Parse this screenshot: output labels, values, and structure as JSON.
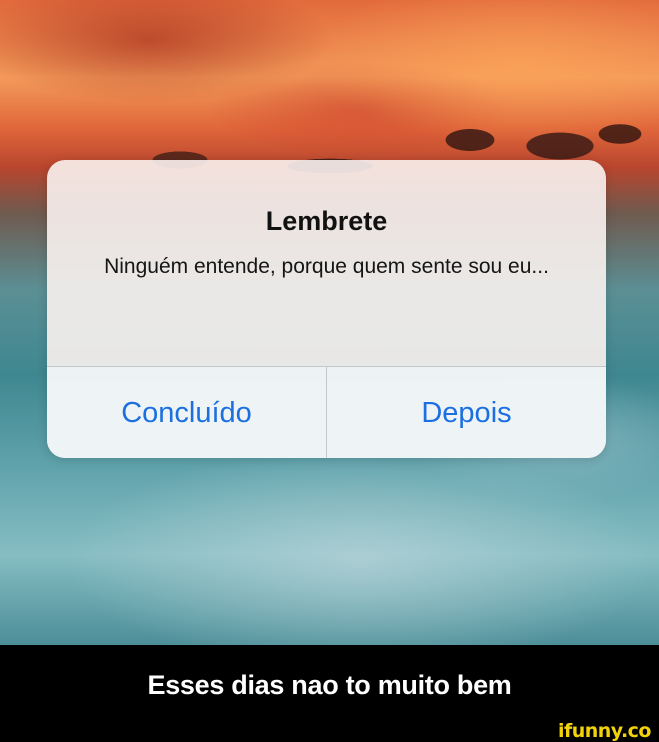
{
  "alert": {
    "title": "Lembrete",
    "message": "Ninguém entende, porque quem sente sou eu...",
    "actions": [
      {
        "label": "Concluído"
      },
      {
        "label": "Depois"
      }
    ]
  },
  "caption": "Esses dias nao to muito bem",
  "watermark": "ifunny.co",
  "colors": {
    "action_blue": "#1b6fe0",
    "watermark_yellow": "#f2d20a"
  }
}
